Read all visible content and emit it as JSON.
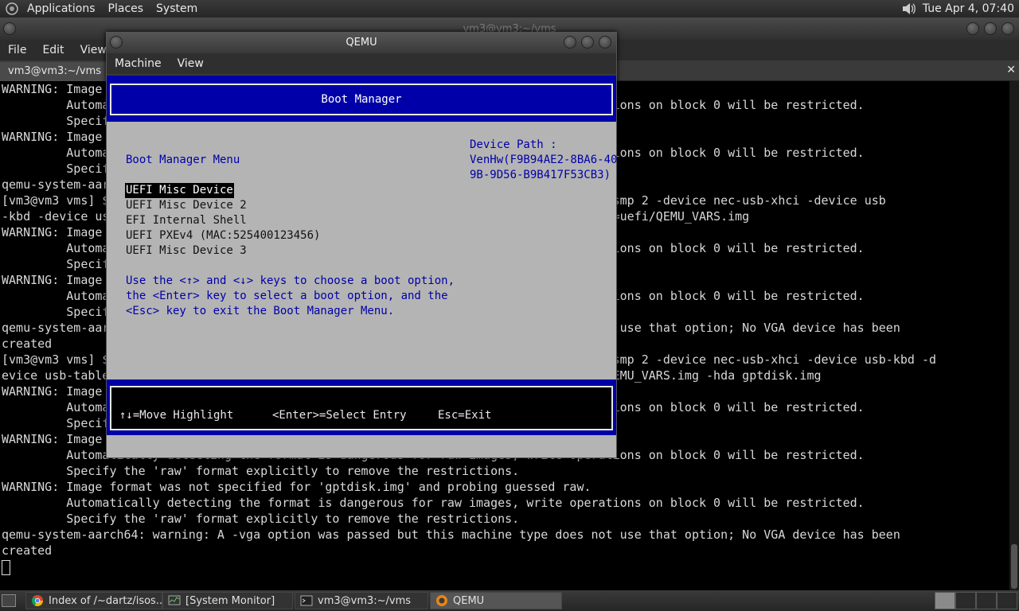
{
  "top_panel": {
    "menus": [
      "Applications",
      "Places",
      "System"
    ],
    "datetime": "Tue Apr  4, 07:40"
  },
  "terminal_window": {
    "title": "vm3@vm3:~/vms",
    "menus": [
      "File",
      "Edit",
      "View"
    ],
    "tab_label": "vm3@vm3:~/vms",
    "lines": [
      "WARNING: Image format was not specified for 'gptdisk.img' and probing guessed raw.",
      "         Automatically detecting the format is dangerous for raw images, write operations on block 0 will be restricted.",
      "         Specify the 'raw' format explicitly to remove the restrictions.",
      "WARNING: Image format was not specified for 'gptdisk.img' and probing guessed raw.",
      "         Automatically detecting the format is dangerous for raw images, write operations on block 0 will be restricted.",
      "         Specify the 'raw' format explicitly to remove the restrictions.",
      "qemu-system-aarch64: warning: A -vga option was passed",
      "[vm3@vm3 vms] $ qemu-system-aarch64 -M virt -cpu cortex-a57 -accel tcg,thread=multi -smp 2 -device nec-usb-xhci -device usb",
      "-kbd -device usb-tablet -drive if=pflash,file=uefi/QEMU_EFI.img -drive if=pflash,file=uefi/QEMU_VARS.img",
      "WARNING: Image format was not specified for 'gptdisk.img' and probing guessed raw.",
      "         Automatically detecting the format is dangerous for raw images, write operations on block 0 will be restricted.",
      "         Specify the 'raw' format explicitly to remove the restrictions.",
      "WARNING: Image format was not specified for 'gptdisk.img' and probing guessed raw.",
      "         Automatically detecting the format is dangerous for raw images, write operations on block 0 will be restricted.",
      "         Specify the 'raw' format explicitly to remove the restrictions.",
      "qemu-system-aarch64: warning: A -vga option was passed but this machine type does not use that option; No VGA device has been",
      "created",
      "[vm3@vm3 vms] $ qemu-system-aarch64 -M virt -cpu cortex-a57 -accel tcg,thread=multi -smp 2 -device nec-usb-xhci -device usb-kbd -d",
      "evice usb-tablet -drive if=pflash,file=uefi/QEMU_EFI.img -drive if=pflash,file=uefi/QEMU_VARS.img -hda gptdisk.img",
      "WARNING: Image format was not specified for 'gptdisk.img' and probing guessed raw.",
      "         Automatically detecting the format is dangerous for raw images, write operations on block 0 will be restricted.",
      "         Specify the 'raw' format explicitly to remove the restrictions.",
      "WARNING: Image format was not specified for 'gptdisk.img' and probing guessed raw.",
      "         Automatically detecting the format is dangerous for raw images, write operations on block 0 will be restricted.",
      "         Specify the 'raw' format explicitly to remove the restrictions.",
      "WARNING: Image format was not specified for 'gptdisk.img' and probing guessed raw.",
      "         Automatically detecting the format is dangerous for raw images, write operations on block 0 will be restricted.",
      "         Specify the 'raw' format explicitly to remove the restrictions.",
      "qemu-system-aarch64: warning: A -vga option was passed but this machine type does not use that option; No VGA device has been",
      "created"
    ]
  },
  "qemu_window": {
    "title": "QEMU",
    "menus": [
      "Machine",
      "View"
    ],
    "boot_manager": {
      "header": "Boot Manager",
      "menu_title": "Boot Manager Menu",
      "device_path_lines": [
        "Device Path :",
        "VenHw(F9B94AE2-8BA6-40",
        "9B-9D56-B9B417F53CB3)"
      ],
      "options": [
        "UEFI Misc Device",
        "UEFI Misc Device 2",
        "EFI Internal Shell",
        "UEFI PXEv4 (MAC:525400123456)",
        "UEFI Misc Device 3"
      ],
      "help_lines": [
        "Use the <↑> and <↓> keys to choose a boot option,",
        "the <Enter> key to select a boot option, and the",
        "<Esc> key to exit the Boot Manager Menu."
      ],
      "footer": {
        "move": "↑↓=Move Highlight",
        "select": "<Enter>=Select Entry",
        "exit": "Esc=Exit"
      }
    }
  },
  "taskbar": {
    "tasks": [
      "Index of /~dartz/isos...",
      "[System Monitor]",
      "vm3@vm3:~/vms",
      "QEMU"
    ]
  },
  "colors": {
    "uefi_blue": "#0000a8",
    "uefi_gray": "#b4b4b4",
    "terminal_bg": "#000000"
  }
}
